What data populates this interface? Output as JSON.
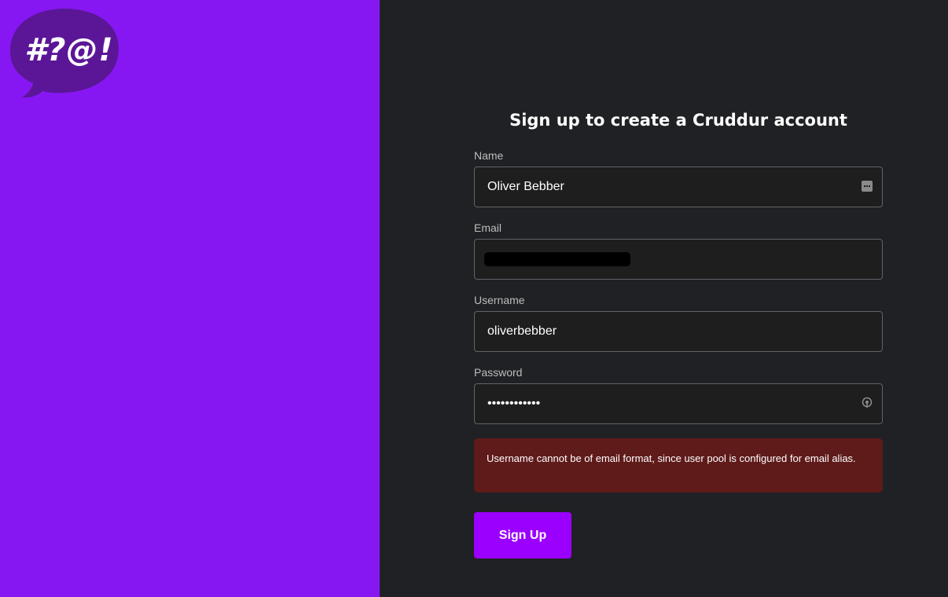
{
  "brand": {
    "logo_text": "#?@!",
    "logo_bg": "#5b1697",
    "panel_color": "#8717f2"
  },
  "form": {
    "title": "Sign up to create a Cruddur account",
    "name": {
      "label": "Name",
      "value": "Oliver Bebber",
      "icon": "autofill-contact-icon"
    },
    "email": {
      "label": "Email",
      "value": ""
    },
    "username": {
      "label": "Username",
      "value": "oliverbebber"
    },
    "password": {
      "label": "Password",
      "value": "••••••••••••",
      "icon": "password-reveal-icon"
    },
    "error": "Username cannot be of email format, since user pool is configured for email alias.",
    "submit_label": "Sign Up"
  },
  "colors": {
    "background": "#202124",
    "accent": "#9b00ff",
    "error_bg": "#5f1a1a"
  }
}
